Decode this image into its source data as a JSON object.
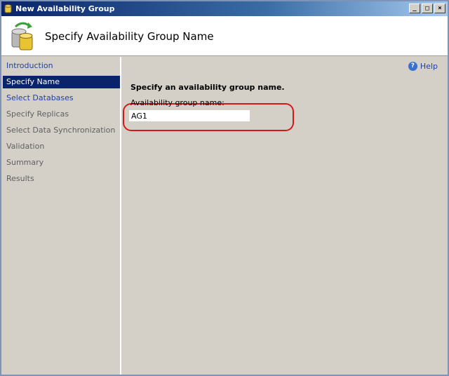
{
  "window": {
    "title": "New Availability Group",
    "buttons": [
      "_",
      "□",
      "×"
    ]
  },
  "header": {
    "title": "Specify Availability Group Name",
    "icon": "database-sync-icon"
  },
  "sidebar": {
    "items": [
      {
        "label": "Introduction",
        "state": "link"
      },
      {
        "label": "Specify Name",
        "state": "active"
      },
      {
        "label": "Select Databases",
        "state": "link"
      },
      {
        "label": "Specify Replicas",
        "state": "disabled"
      },
      {
        "label": "Select Data Synchronization",
        "state": "disabled"
      },
      {
        "label": "Validation",
        "state": "disabled"
      },
      {
        "label": "Summary",
        "state": "disabled"
      },
      {
        "label": "Results",
        "state": "disabled"
      }
    ]
  },
  "main": {
    "help_label": "Help",
    "section_title": "Specify an availability group name.",
    "field_label": "Availability group name:",
    "field_value": "AG1"
  },
  "colors": {
    "accent": "#0a246a",
    "link": "#1f3fa6",
    "highlight": "#d11a1a"
  }
}
